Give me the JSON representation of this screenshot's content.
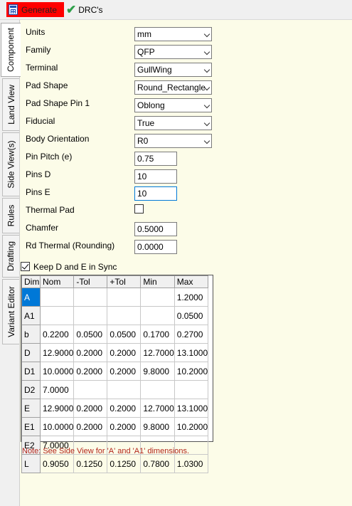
{
  "toolbar": {
    "generate_label": "Generate",
    "drc_label": "DRC's"
  },
  "tabs": [
    "Component",
    "Land View",
    "Side View(s)",
    "Rules",
    "Drafting",
    "Variant Editor"
  ],
  "properties": {
    "units": {
      "label": "Units",
      "value": "mm"
    },
    "family": {
      "label": "Family",
      "value": "QFP"
    },
    "terminal": {
      "label": "Terminal",
      "value": "GullWing"
    },
    "pad_shape": {
      "label": "Pad Shape",
      "value": "Round_Rectangle"
    },
    "pad_shape_pin1": {
      "label": "Pad Shape Pin 1",
      "value": "Oblong"
    },
    "fiducial": {
      "label": "Fiducial",
      "value": "True"
    },
    "body_orientation": {
      "label": "Body Orientation",
      "value": "R0"
    },
    "pin_pitch": {
      "label": "Pin Pitch (e)",
      "value": "0.75"
    },
    "pins_d": {
      "label": "Pins D",
      "value": "10"
    },
    "pins_e": {
      "label": "Pins E",
      "value": "10"
    },
    "thermal_pad": {
      "label": "Thermal Pad",
      "checked": false
    },
    "chamfer": {
      "label": "Chamfer",
      "value": "0.5000"
    },
    "rd_thermal": {
      "label": "Rd Thermal (Rounding)",
      "value": "0.0000"
    }
  },
  "sync": {
    "label": "Keep D and E in Sync",
    "checked": true
  },
  "grid": {
    "headers": [
      "Dim",
      "Nom",
      "-Tol",
      "+Tol",
      "Min",
      "Max"
    ],
    "rows": [
      [
        "A",
        "",
        "",
        "",
        "",
        "1.2000"
      ],
      [
        "A1",
        "",
        "",
        "",
        "",
        "0.0500"
      ],
      [
        "b",
        "0.2200",
        "0.0500",
        "0.0500",
        "0.1700",
        "0.2700"
      ],
      [
        "D",
        "12.9000",
        "0.2000",
        "0.2000",
        "12.7000",
        "13.1000"
      ],
      [
        "D1",
        "10.0000",
        "0.2000",
        "0.2000",
        "9.8000",
        "10.2000"
      ],
      [
        "D2",
        "7.0000",
        "",
        "",
        "",
        ""
      ],
      [
        "E",
        "12.9000",
        "0.2000",
        "0.2000",
        "12.7000",
        "13.1000"
      ],
      [
        "E1",
        "10.0000",
        "0.2000",
        "0.2000",
        "9.8000",
        "10.2000"
      ],
      [
        "E2",
        "7.0000",
        "",
        "",
        "",
        ""
      ],
      [
        "L",
        "0.9050",
        "0.1250",
        "0.1250",
        "0.7800",
        "1.0300"
      ]
    ]
  },
  "note": "Note:  See Side View for 'A' and 'A1' dimensions."
}
